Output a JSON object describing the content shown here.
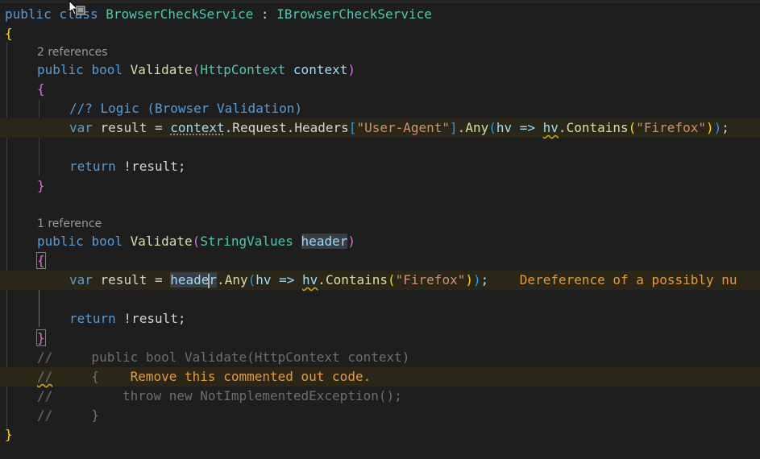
{
  "code": {
    "line1": {
      "kw_public": "public",
      "kw_class": "class",
      "class_name": "BrowserCheckService",
      "colon": " : ",
      "interface_name": "IBrowserCheckService"
    },
    "open_brace": "{",
    "close_brace": "}",
    "method1": {
      "codelens": "2 references",
      "kw_public": "public",
      "kw_bool": "bool",
      "name": "Validate",
      "param_type": "HttpContext",
      "param_name": "context",
      "open_brace": "{",
      "comment": "//? Logic (Browser Validation)",
      "var_kw": "var",
      "result_text": " result = ",
      "expr_context": "context",
      "expr_request": ".Request.Headers",
      "string_ua": "\"User-Agent\"",
      "any_fn": "Any",
      "lambda_hv": "hv => ",
      "hv": "hv",
      "contains_fn": "Contains",
      "string_ff": "\"Firefox\"",
      "end": ");",
      "return_kw": "return",
      "return_expr": " !result;",
      "close_brace": "}"
    },
    "method2": {
      "codelens": "1 reference",
      "kw_public": "public",
      "kw_bool": "bool",
      "name": "Validate",
      "param_type": "StringValues",
      "param_name": "header",
      "open_brace": "{",
      "var_kw": "var",
      "result_text": " result = ",
      "header_a": "heade",
      "header_b": "r",
      "any_fn": "Any",
      "lambda_hv": "hv => ",
      "hv": "hv",
      "contains_fn": "Contains",
      "string_ff": "\"Firefox\"",
      "end": ");",
      "warning": "Dereference of a possibly nu",
      "return_kw": "return",
      "return_expr": " !result;",
      "close_brace": "}"
    },
    "commented": {
      "line1": "//     public bool Validate(HttpContext context)",
      "line2_slashes": "//",
      "line2_rest": "     {",
      "line2_warning": "Remove this commented out code.",
      "line3": "//         throw new NotImplementedException();",
      "line4": "//     }"
    }
  }
}
